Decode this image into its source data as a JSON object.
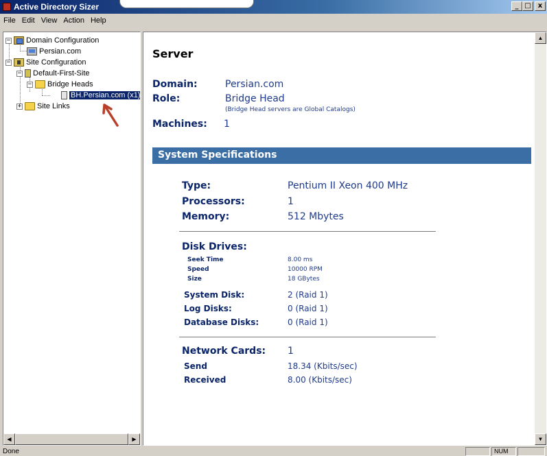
{
  "window": {
    "title": "Active Directory Sizer"
  },
  "window_buttons": {
    "minimize": "_",
    "maximize": "□",
    "close": "x"
  },
  "menu": [
    "File",
    "Edit",
    "View",
    "Action",
    "Help"
  ],
  "tree": {
    "domain_configuration": "Domain Configuration",
    "domain": "Persian.com",
    "site_configuration": "Site Configuration",
    "site": "Default-First-Site",
    "bridge_heads": "Bridge Heads",
    "server": "BH.Persian.com (x1)",
    "site_links": "Site Links",
    "expand_symbol": "−",
    "collapse_symbol": "+"
  },
  "server": {
    "heading": "Server",
    "domain_label": "Domain:",
    "domain_value": "Persian.com",
    "role_label": "Role:",
    "role_value": "Bridge Head",
    "role_note": "(Bridge Head servers are Global Catalogs)",
    "machines_label": "Machines:",
    "machines_value": "1"
  },
  "specs": {
    "heading": "System Specifications",
    "type_label": "Type:",
    "type_value": "Pentium II Xeon 400 MHz",
    "processors_label": "Processors:",
    "processors_value": "1",
    "memory_label": "Memory:",
    "memory_value": "512 Mbytes",
    "disk_heading": "Disk Drives:",
    "seek_label": "Seek Time",
    "seek_value": "8.00 ms",
    "speed_label": "Speed",
    "speed_value": "10000 RPM",
    "size_label": "Size",
    "size_value": "18 GBytes",
    "system_disk_label": "System Disk:",
    "system_disk_value": "2 (Raid 1)",
    "log_disks_label": "Log Disks:",
    "log_disks_value": "0 (Raid 1)",
    "db_disks_label": "Database Disks:",
    "db_disks_value": "0 (Raid 1)",
    "network_label": "Network Cards:",
    "network_value": "1",
    "send_label": "Send",
    "send_value": "18.34 (Kbits/sec)",
    "received_label": "Received",
    "received_value": "8.00 (Kbits/sec)"
  },
  "status": {
    "text": "Done",
    "num": "NUM"
  },
  "colors": {
    "accent": "#3b6ea5",
    "title_bar": "#0a246a",
    "annotation_arrow": "#b8402a"
  }
}
